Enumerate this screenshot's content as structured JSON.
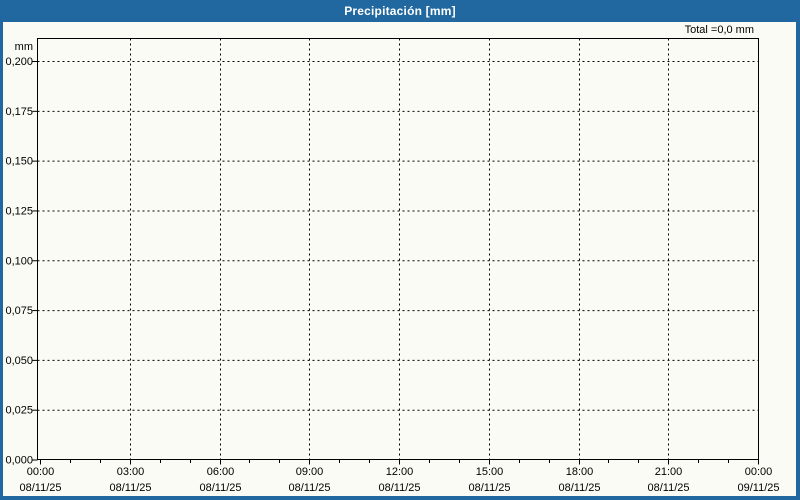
{
  "title": "Precipitación [mm]",
  "total_label": "Total =0,0 mm",
  "colors": {
    "header_bg": "#20689f",
    "header_text": "#ffffff",
    "panel_border": "#20689f",
    "panel_bg": "#fbfbf5",
    "axis": "#000000",
    "grid": "#000000",
    "text": "#000000"
  },
  "chart_data": {
    "type": "bar",
    "title": "Precipitación [mm]",
    "ylabel": "mm",
    "total_annotation": "Total =0,0 mm",
    "ylim": [
      0,
      0.2
    ],
    "ytick_labels": [
      "0,200",
      "0,175",
      "0,150",
      "0,125",
      "0,100",
      "0,075",
      "0,050",
      "0,025",
      "0,000"
    ],
    "ytick_values": [
      0.2,
      0.175,
      0.15,
      0.125,
      0.1,
      0.075,
      0.05,
      0.025,
      0.0
    ],
    "grid": "dashed",
    "legend": "none",
    "x_axis": {
      "minor_ticks_per_major_interval": 2,
      "major_ticks": [
        {
          "time": "00:00",
          "date": "08/11/25"
        },
        {
          "time": "03:00",
          "date": "08/11/25"
        },
        {
          "time": "06:00",
          "date": "08/11/25"
        },
        {
          "time": "09:00",
          "date": "08/11/25"
        },
        {
          "time": "12:00",
          "date": "08/11/25"
        },
        {
          "time": "15:00",
          "date": "08/11/25"
        },
        {
          "time": "18:00",
          "date": "08/11/25"
        },
        {
          "time": "21:00",
          "date": "08/11/25"
        },
        {
          "time": "00:00",
          "date": "09/11/25"
        }
      ]
    },
    "series": [
      {
        "name": "Precipitación",
        "values": [],
        "total_mm": "0,0"
      }
    ]
  }
}
